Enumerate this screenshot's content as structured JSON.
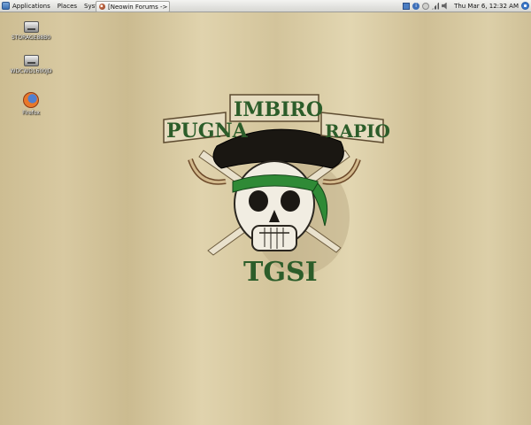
{
  "panel": {
    "menus": [
      "Applications",
      "Places",
      "System"
    ],
    "task_button_label": "[Neowin Forums -> C...",
    "clock": "Thu Mar  6, 12:32 AM",
    "info_glyph": "i"
  },
  "desktop": {
    "icons": [
      {
        "label": "STORAGE88B0",
        "icon": "drive-icon"
      },
      {
        "label": "WDCWD1600JD",
        "icon": "drive-icon"
      },
      {
        "label": "Firefox",
        "icon": "firefox-icon"
      }
    ]
  },
  "wallpaper": {
    "banner_left": "PUGNA",
    "banner_center": "IMBIRO",
    "banner_right": "RAPIO",
    "emblem_text": "TGSI",
    "colors": {
      "background": "#d6c79e",
      "bandana": "#2f8a36",
      "banner": "#e6dcc0",
      "text_green": "#2c5d2a"
    }
  }
}
